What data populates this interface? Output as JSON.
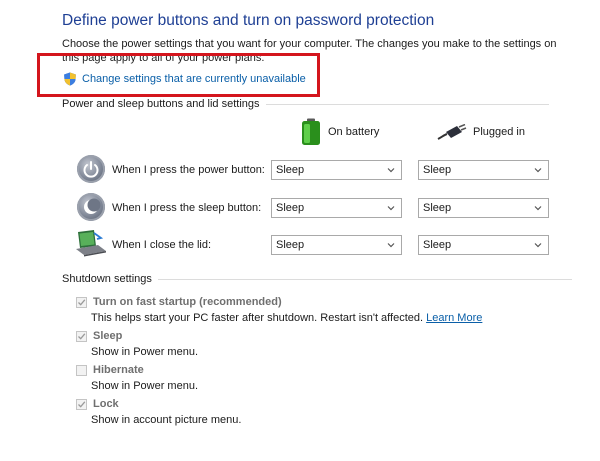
{
  "page": {
    "title": "Define power buttons and turn on password protection",
    "intro": "Choose the power settings that you want for your computer. The changes you make to the settings on this page apply to all of your power plans."
  },
  "change_link": {
    "label": "Change settings that are currently unavailable"
  },
  "power_section": {
    "heading": "Power and sleep buttons and lid settings",
    "col_battery": "On battery",
    "col_plugged": "Plugged in",
    "rows": [
      {
        "label": "When I press the power button:",
        "battery": "Sleep",
        "plugged": "Sleep",
        "icon": "power-button-icon"
      },
      {
        "label": "When I press the sleep button:",
        "battery": "Sleep",
        "plugged": "Sleep",
        "icon": "sleep-button-icon"
      },
      {
        "label": "When I close the lid:",
        "battery": "Sleep",
        "plugged": "Sleep",
        "icon": "laptop-lid-icon"
      }
    ]
  },
  "shutdown_section": {
    "heading": "Shutdown settings",
    "items": [
      {
        "label": "Turn on fast startup (recommended)",
        "checked": true,
        "desc": "This helps start your PC faster after shutdown. Restart isn't affected.",
        "desc_link": "Learn More"
      },
      {
        "label": "Sleep",
        "checked": true,
        "desc": "Show in Power menu."
      },
      {
        "label": "Hibernate",
        "checked": false,
        "desc": "Show in Power menu."
      },
      {
        "label": "Lock",
        "checked": true,
        "desc": "Show in account picture menu."
      }
    ]
  },
  "colors": {
    "title": "#1e3f94",
    "link": "#0a5fa8",
    "highlight": "#d4151d"
  }
}
